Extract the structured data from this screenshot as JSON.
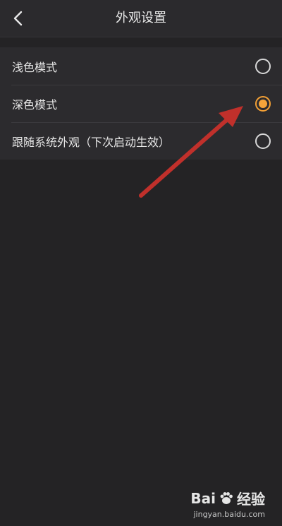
{
  "header": {
    "title": "外观设置",
    "back_icon": "chevron-left-icon"
  },
  "options": [
    {
      "label": "浅色模式",
      "selected": false
    },
    {
      "label": "深色模式",
      "selected": true
    },
    {
      "label": "跟随系统外观（下次启动生效）",
      "selected": false
    }
  ],
  "colors": {
    "background": "#242325",
    "list_background": "#2c2b2e",
    "accent": "#f5a43a",
    "annotation_arrow": "#c0302b"
  },
  "watermark": {
    "brand_left": "Bai",
    "brand_right": "经验",
    "url": "jingyan.baidu.com"
  }
}
